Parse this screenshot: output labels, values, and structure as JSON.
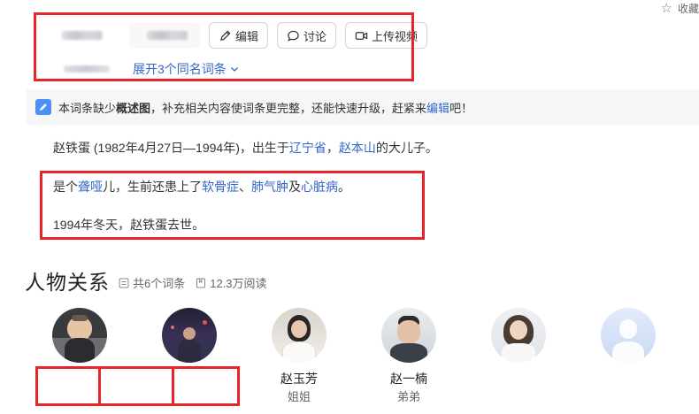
{
  "header": {
    "collect_label": "收藏"
  },
  "actions": {
    "edit_label": "编辑",
    "discuss_label": "讨论",
    "upload_label": "上传视频"
  },
  "expand_label": "展开3个同名词条",
  "notice": {
    "prefix": "本词条缺少",
    "bold": "概述图",
    "middle": "，补充相关内容使词条更完整，还能快速升级，赶紧来",
    "link": "编辑",
    "suffix": "吧！"
  },
  "intro": {
    "p1_a": "赵铁蛋 (1982年4月27日—1994年)，出生于",
    "p1_link1": "辽宁省",
    "p1_b": "，",
    "p1_link2": "赵本山",
    "p1_c": "的大儿子。",
    "p2_a": "是个",
    "p2_link1": "聋哑",
    "p2_b": "儿，生前还患上了",
    "p2_link2": "软骨症",
    "p2_c": "、",
    "p2_link3": "肺气肿",
    "p2_d": "及",
    "p2_link4": "心脏病",
    "p2_e": "。",
    "p3": "1994年冬天，赵铁蛋去世。"
  },
  "relations": {
    "title": "人物关系",
    "entries": "共6个词条",
    "views": "12.3万阅读",
    "people": [
      {
        "name": "",
        "role": ""
      },
      {
        "name": "",
        "role": ""
      },
      {
        "name": "赵玉芳",
        "role": "姐姐"
      },
      {
        "name": "赵一楠",
        "role": "弟弟"
      },
      {
        "name": "",
        "role": ""
      },
      {
        "name": "",
        "role": ""
      }
    ]
  },
  "colors": {
    "link": "#3466c9",
    "annotation_red": "#e8242b",
    "notice_bg": "#f5f6f8"
  }
}
